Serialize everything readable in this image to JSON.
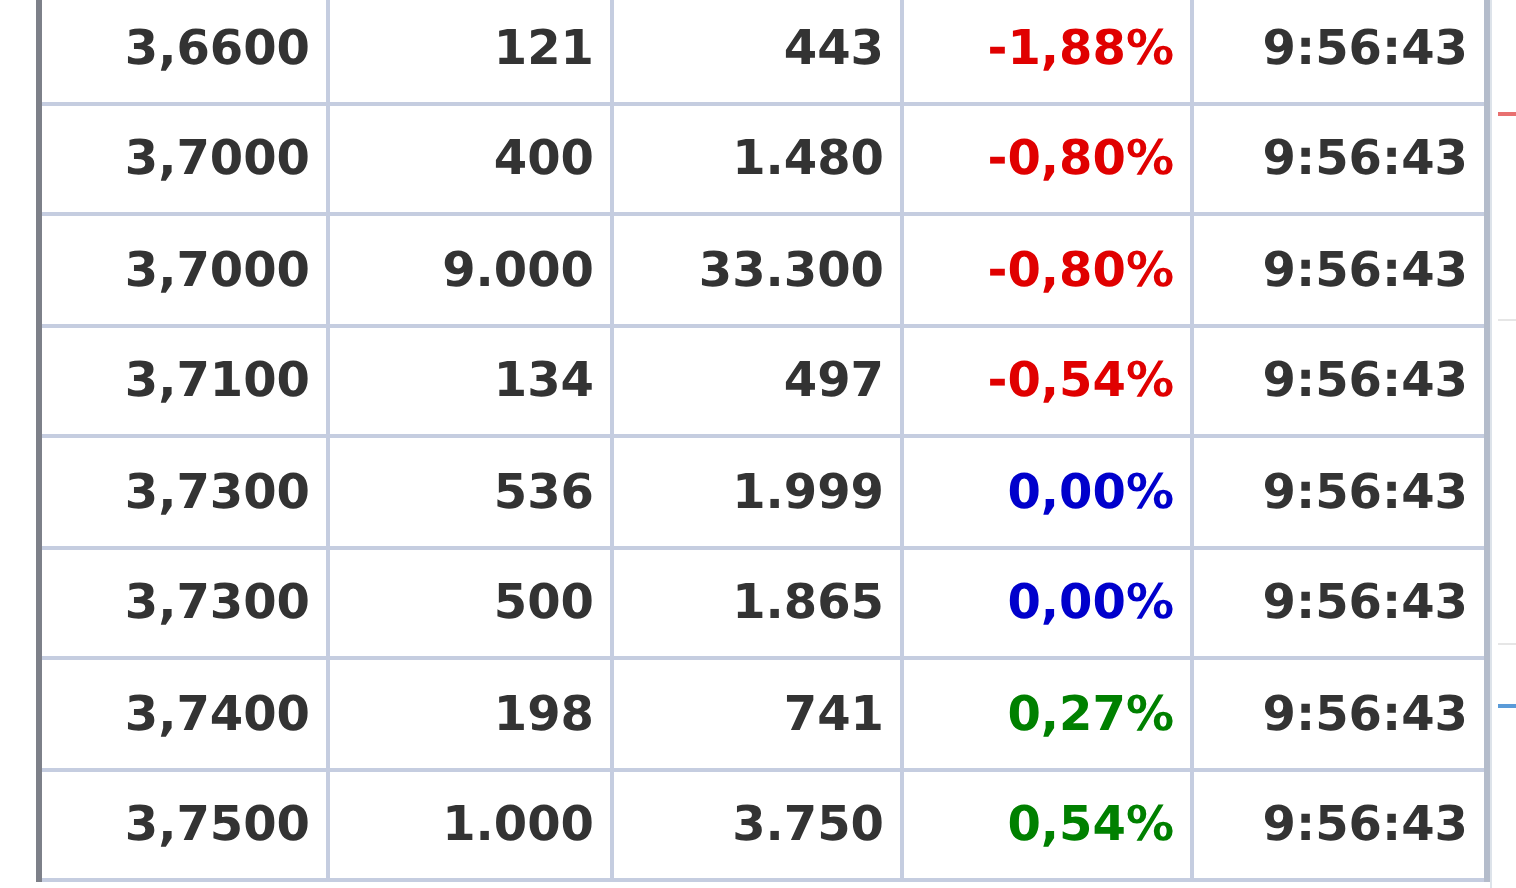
{
  "rows": [
    {
      "price": "3,6600",
      "volume": "121",
      "value": "443",
      "change": "-1,88%",
      "color": "#e00000",
      "time": "9:56:43"
    },
    {
      "price": "3,7000",
      "volume": "400",
      "value": "1.480",
      "change": "-0,80%",
      "color": "#e00000",
      "time": "9:56:43"
    },
    {
      "price": "3,7000",
      "volume": "9.000",
      "value": "33.300",
      "change": "-0,80%",
      "color": "#e00000",
      "time": "9:56:43"
    },
    {
      "price": "3,7100",
      "volume": "134",
      "value": "497",
      "change": "-0,54%",
      "color": "#e00000",
      "time": "9:56:43"
    },
    {
      "price": "3,7300",
      "volume": "536",
      "value": "1.999",
      "change": "0,00%",
      "color": "#0000cc",
      "time": "9:56:43"
    },
    {
      "price": "3,7300",
      "volume": "500",
      "value": "1.865",
      "change": "0,00%",
      "color": "#0000cc",
      "time": "9:56:43"
    },
    {
      "price": "3,7400",
      "volume": "198",
      "value": "741",
      "change": "0,27%",
      "color": "#008000",
      "time": "9:56:43"
    },
    {
      "price": "3,7500",
      "volume": "1.000",
      "value": "3.750",
      "change": "0,54%",
      "color": "#008000",
      "time": "9:56:43"
    }
  ]
}
